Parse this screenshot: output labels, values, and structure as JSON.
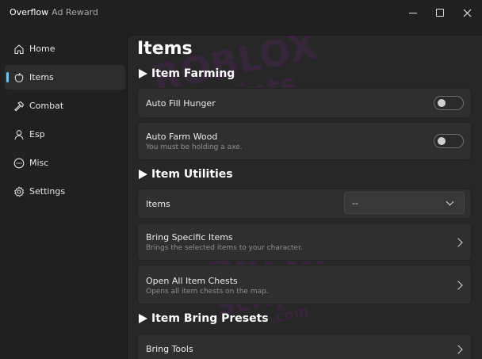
{
  "window": {
    "title": "Overflow",
    "subtitle": "Ad Reward",
    "controls": [
      "minimize",
      "maximize",
      "close"
    ]
  },
  "sidebar": {
    "items": [
      {
        "label": "Home",
        "icon": "home-icon",
        "active": false
      },
      {
        "label": "Items",
        "icon": "apple-icon",
        "active": true
      },
      {
        "label": "Combat",
        "icon": "hammer-icon",
        "active": false
      },
      {
        "label": "Esp",
        "icon": "person-icon",
        "active": false
      },
      {
        "label": "Misc",
        "icon": "more-icon",
        "active": false
      },
      {
        "label": "Settings",
        "icon": "gear-icon",
        "active": false
      }
    ]
  },
  "main": {
    "title": "Items",
    "sections": {
      "farming": {
        "header": "Item Farming",
        "auto_fill_hunger": {
          "label": "Auto Fill Hunger",
          "enabled": false
        },
        "auto_farm_wood": {
          "label": "Auto Farm Wood",
          "description": "You must be holding a axe.",
          "enabled": false
        }
      },
      "utilities": {
        "header": "Item Utilities",
        "items_dropdown": {
          "label": "Items",
          "value": "--"
        },
        "bring_specific": {
          "label": "Bring Specific Items",
          "description": "Brings the selected items to your character."
        },
        "open_chests": {
          "label": "Open All Item Chests",
          "description": "Opens all item chests on the map."
        }
      },
      "presets": {
        "header": "Item Bring Presets",
        "bring_tools": {
          "label": "Bring Tools"
        }
      }
    }
  },
  "watermark": {
    "line1": "ROBLOX",
    "line2": "Scripts",
    "line3": ".com"
  },
  "colors": {
    "accent": "#6cc3f5",
    "background": "#202020",
    "panel": "#272727",
    "card": "#2f2f2f"
  }
}
